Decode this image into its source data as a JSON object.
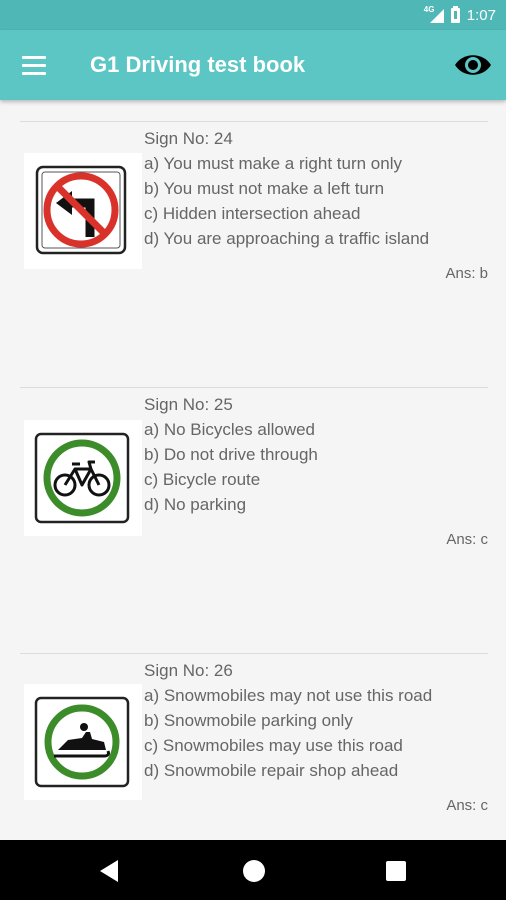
{
  "status": {
    "network": "4G",
    "time": "1:07"
  },
  "app_bar": {
    "title": "G1 Driving test book"
  },
  "questions": [
    {
      "sign": "Sign No: 24",
      "options": [
        "a) You must make a right turn only",
        "b) You must not make a left turn",
        "c) Hidden intersection ahead",
        "d) You are approaching a traffic island"
      ],
      "answer": "Ans: b"
    },
    {
      "sign": "Sign No: 25",
      "options": [
        "a) No Bicycles allowed",
        "b) Do not drive through",
        "c) Bicycle route",
        "d) No parking"
      ],
      "answer": "Ans: c"
    },
    {
      "sign": "Sign No: 26",
      "options": [
        "a) Snowmobiles may not use this road",
        "b) Snowmobile parking only",
        "c) Snowmobiles may use this road",
        "d) Snowmobile repair shop ahead"
      ],
      "answer": "Ans: c"
    }
  ],
  "colors": {
    "accent": "#5bc6c4",
    "status_bar": "#4fb8b6",
    "prohibition_red": "#d9322b",
    "permissive_green": "#3c8c2a"
  }
}
